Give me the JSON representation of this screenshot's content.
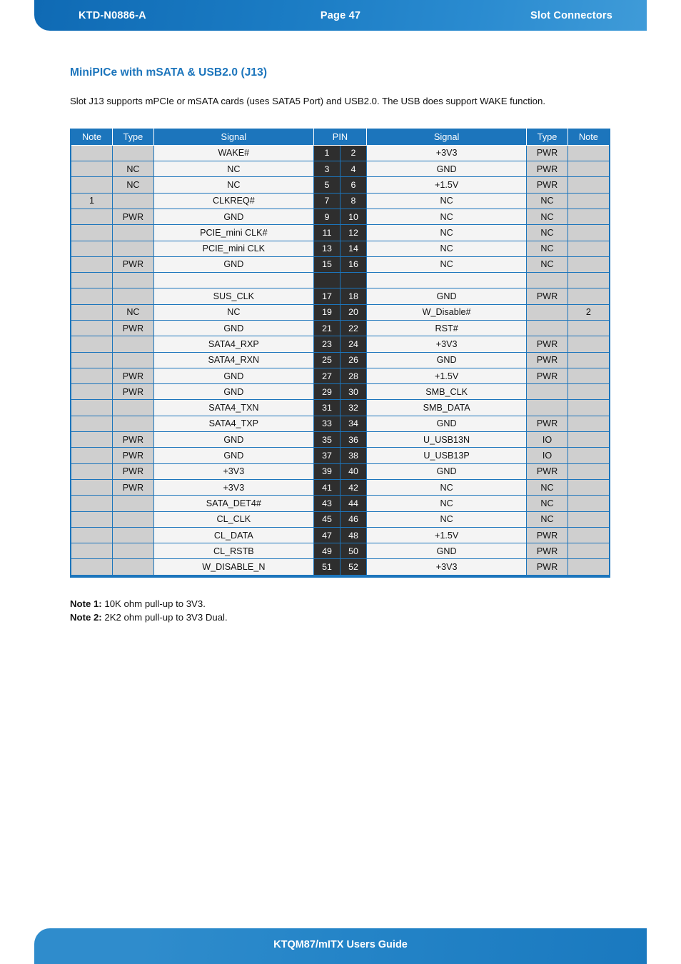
{
  "header": {
    "doc_id": "KTD-N0886-A",
    "page_label": "Page 47",
    "section": "Slot Connectors"
  },
  "footer": {
    "text": "KTQM87/mITX Users Guide"
  },
  "main": {
    "section_title": "MiniPICe with mSATA & USB2.0 (J13)",
    "intro": "Slot J13 supports mPCIe or mSATA cards (uses SATA5 Port) and USB2.0. The USB does support WAKE function."
  },
  "colors": {
    "accent_blue": "#1c75bc",
    "pin_dark": "#2e2e2e",
    "cell_gray": "#cfcfcf",
    "cell_light": "#f4f4f4"
  },
  "table": {
    "headers": {
      "note_left": "Note",
      "type_left": "Type",
      "signal_left": "Signal",
      "pin": "PIN",
      "signal_right": "Signal",
      "type_right": "Type",
      "note_right": "Note"
    },
    "rows": [
      {
        "note_l": "",
        "type_l": "",
        "signal_l": "WAKE#",
        "pin_l": "1",
        "pin_r": "2",
        "signal_r": "+3V3",
        "type_r": "PWR",
        "note_r": ""
      },
      {
        "note_l": "",
        "type_l": "NC",
        "signal_l": "NC",
        "pin_l": "3",
        "pin_r": "4",
        "signal_r": "GND",
        "type_r": "PWR",
        "note_r": ""
      },
      {
        "note_l": "",
        "type_l": "NC",
        "signal_l": "NC",
        "pin_l": "5",
        "pin_r": "6",
        "signal_r": "+1.5V",
        "type_r": "PWR",
        "note_r": ""
      },
      {
        "note_l": "1",
        "type_l": "",
        "signal_l": "CLKREQ#",
        "pin_l": "7",
        "pin_r": "8",
        "signal_r": "NC",
        "type_r": "NC",
        "note_r": ""
      },
      {
        "note_l": "",
        "type_l": "PWR",
        "signal_l": "GND",
        "pin_l": "9",
        "pin_r": "10",
        "signal_r": "NC",
        "type_r": "NC",
        "note_r": ""
      },
      {
        "note_l": "",
        "type_l": "",
        "signal_l": "PCIE_mini CLK#",
        "pin_l": "11",
        "pin_r": "12",
        "signal_r": "NC",
        "type_r": "NC",
        "note_r": ""
      },
      {
        "note_l": "",
        "type_l": "",
        "signal_l": "PCIE_mini CLK",
        "pin_l": "13",
        "pin_r": "14",
        "signal_r": "NC",
        "type_r": "NC",
        "note_r": ""
      },
      {
        "note_l": "",
        "type_l": "PWR",
        "signal_l": "GND",
        "pin_l": "15",
        "pin_r": "16",
        "signal_r": "NC",
        "type_r": "NC",
        "note_r": ""
      },
      {
        "note_l": "",
        "type_l": "",
        "signal_l": "",
        "pin_l": "",
        "pin_r": "",
        "signal_r": "",
        "type_r": "",
        "note_r": "",
        "gap": true
      },
      {
        "note_l": "",
        "type_l": "",
        "signal_l": "SUS_CLK",
        "pin_l": "17",
        "pin_r": "18",
        "signal_r": "GND",
        "type_r": "PWR",
        "note_r": ""
      },
      {
        "note_l": "",
        "type_l": "NC",
        "signal_l": "NC",
        "pin_l": "19",
        "pin_r": "20",
        "signal_r": "W_Disable#",
        "type_r": "",
        "note_r": "2"
      },
      {
        "note_l": "",
        "type_l": "PWR",
        "signal_l": "GND",
        "pin_l": "21",
        "pin_r": "22",
        "signal_r": "RST#",
        "type_r": "",
        "note_r": ""
      },
      {
        "note_l": "",
        "type_l": "",
        "signal_l": "SATA4_RXP",
        "pin_l": "23",
        "pin_r": "24",
        "signal_r": "+3V3",
        "type_r": "PWR",
        "note_r": ""
      },
      {
        "note_l": "",
        "type_l": "",
        "signal_l": "SATA4_RXN",
        "pin_l": "25",
        "pin_r": "26",
        "signal_r": "GND",
        "type_r": "PWR",
        "note_r": ""
      },
      {
        "note_l": "",
        "type_l": "PWR",
        "signal_l": "GND",
        "pin_l": "27",
        "pin_r": "28",
        "signal_r": "+1.5V",
        "type_r": "PWR",
        "note_r": ""
      },
      {
        "note_l": "",
        "type_l": "PWR",
        "signal_l": "GND",
        "pin_l": "29",
        "pin_r": "30",
        "signal_r": "SMB_CLK",
        "type_r": "",
        "note_r": ""
      },
      {
        "note_l": "",
        "type_l": "",
        "signal_l": "SATA4_TXN",
        "pin_l": "31",
        "pin_r": "32",
        "signal_r": "SMB_DATA",
        "type_r": "",
        "note_r": ""
      },
      {
        "note_l": "",
        "type_l": "",
        "signal_l": "SATA4_TXP",
        "pin_l": "33",
        "pin_r": "34",
        "signal_r": "GND",
        "type_r": "PWR",
        "note_r": ""
      },
      {
        "note_l": "",
        "type_l": "PWR",
        "signal_l": "GND",
        "pin_l": "35",
        "pin_r": "36",
        "signal_r": "U_USB13N",
        "type_r": "IO",
        "note_r": ""
      },
      {
        "note_l": "",
        "type_l": "PWR",
        "signal_l": "GND",
        "pin_l": "37",
        "pin_r": "38",
        "signal_r": "U_USB13P",
        "type_r": "IO",
        "note_r": ""
      },
      {
        "note_l": "",
        "type_l": "PWR",
        "signal_l": "+3V3",
        "pin_l": "39",
        "pin_r": "40",
        "signal_r": "GND",
        "type_r": "PWR",
        "note_r": ""
      },
      {
        "note_l": "",
        "type_l": "PWR",
        "signal_l": "+3V3",
        "pin_l": "41",
        "pin_r": "42",
        "signal_r": "NC",
        "type_r": "NC",
        "note_r": ""
      },
      {
        "note_l": "",
        "type_l": "",
        "signal_l": "SATA_DET4#",
        "pin_l": "43",
        "pin_r": "44",
        "signal_r": "NC",
        "type_r": "NC",
        "note_r": ""
      },
      {
        "note_l": "",
        "type_l": "",
        "signal_l": "CL_CLK",
        "pin_l": "45",
        "pin_r": "46",
        "signal_r": "NC",
        "type_r": "NC",
        "note_r": ""
      },
      {
        "note_l": "",
        "type_l": "",
        "signal_l": "CL_DATA",
        "pin_l": "47",
        "pin_r": "48",
        "signal_r": "+1.5V",
        "type_r": "PWR",
        "note_r": ""
      },
      {
        "note_l": "",
        "type_l": "",
        "signal_l": "CL_RSTB",
        "pin_l": "49",
        "pin_r": "50",
        "signal_r": "GND",
        "type_r": "PWR",
        "note_r": ""
      },
      {
        "note_l": "",
        "type_l": "",
        "signal_l": "W_DISABLE_N",
        "pin_l": "51",
        "pin_r": "52",
        "signal_r": "+3V3",
        "type_r": "PWR",
        "note_r": ""
      }
    ]
  },
  "notes": [
    {
      "label": "Note 1:",
      "text": " 10K ohm pull-up to 3V3."
    },
    {
      "label": "Note 2:",
      "text": " 2K2 ohm pull-up to 3V3 Dual."
    }
  ]
}
